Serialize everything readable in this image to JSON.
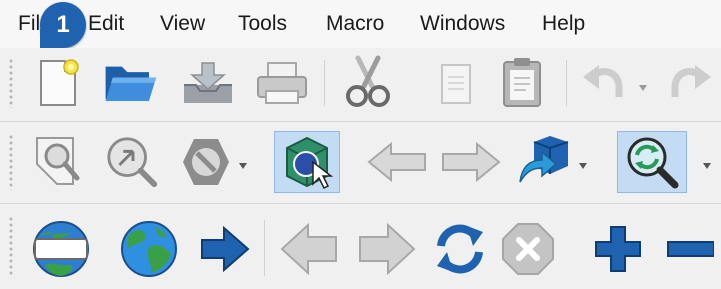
{
  "menubar": {
    "items": [
      {
        "label": "File"
      },
      {
        "label": "Edit"
      },
      {
        "label": "View"
      },
      {
        "label": "Tools"
      },
      {
        "label": "Macro"
      },
      {
        "label": "Windows"
      },
      {
        "label": "Help"
      }
    ]
  },
  "step_badge": {
    "number": "1",
    "color": "#1f63b0"
  },
  "toolbars": {
    "file": [
      "new-document-icon",
      "open-folder-icon",
      "save-tray-icon",
      "print-icon",
      "cut-scissors-icon",
      "copy-icon",
      "paste-clipboard-icon",
      "undo-icon",
      "redo-icon"
    ],
    "view": [
      "zoom-page-icon",
      "navigate-arrow-icon",
      "block-hexagon-icon",
      "3d-cube-view-icon",
      "back-arrow-icon",
      "forward-arrow-icon",
      "export-box-icon",
      "refresh-zoom-icon"
    ],
    "web": [
      "web-page-globe-icon",
      "internet-globe-icon",
      "go-arrow-icon",
      "back-arrow-icon",
      "forward-arrow-icon",
      "refresh-icon",
      "stop-icon",
      "zoom-in-plus-icon",
      "zoom-out-minus-icon"
    ]
  },
  "colors": {
    "accent_blue": "#1f63b0",
    "active_highlight": "#c4dcf3"
  }
}
